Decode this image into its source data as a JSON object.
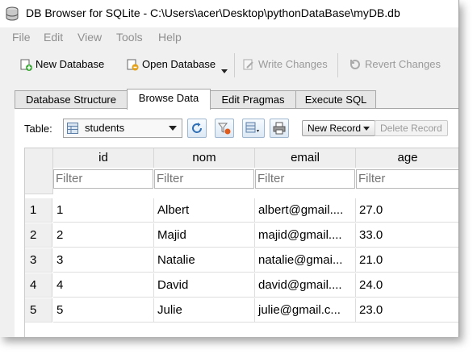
{
  "window": {
    "title": "DB Browser for SQLite - C:\\Users\\acer\\Desktop\\pythonDataBase\\myDB.db"
  },
  "menu": [
    "File",
    "Edit",
    "View",
    "Tools",
    "Help"
  ],
  "toolbar": {
    "new_database": "New Database",
    "open_database": "Open Database",
    "write_changes": "Write Changes",
    "revert_changes": "Revert Changes"
  },
  "tabs": [
    "Database Structure",
    "Browse Data",
    "Edit Pragmas",
    "Execute SQL"
  ],
  "browse": {
    "table_label": "Table:",
    "table_selected": "students",
    "new_record": "New Record",
    "delete_record": "Delete Record",
    "filter_placeholder": "Filter"
  },
  "grid": {
    "columns": [
      "id",
      "nom",
      "email",
      "age"
    ],
    "rows": [
      {
        "num": "1",
        "id": "1",
        "nom": "Albert",
        "email": "albert@gmail....",
        "age": "27.0"
      },
      {
        "num": "2",
        "id": "2",
        "nom": "Majid",
        "email": "majid@gmail....",
        "age": "33.0"
      },
      {
        "num": "3",
        "id": "3",
        "nom": "Natalie",
        "email": "natalie@gmai...",
        "age": "21.0"
      },
      {
        "num": "4",
        "id": "4",
        "nom": "David",
        "email": "david@gmail....",
        "age": "24.0"
      },
      {
        "num": "5",
        "id": "5",
        "nom": "Julie",
        "email": "julie@gmail.c...",
        "age": "23.0"
      }
    ]
  },
  "colors": {
    "accent": "#3a7bd5",
    "disabled_text": "#9a9a9a"
  }
}
